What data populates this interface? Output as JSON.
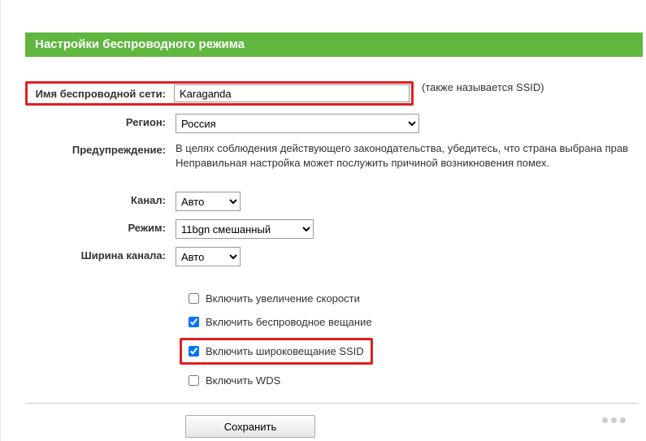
{
  "header": {
    "title": "Настройки беспроводного режима"
  },
  "form": {
    "ssid": {
      "label": "Имя беспроводной сети:",
      "value": "Karaganda",
      "note": "(также называется SSID)"
    },
    "region": {
      "label": "Регион:",
      "value": "Россия"
    },
    "warning": {
      "label": "Предупреждение:",
      "text1": "В целях соблюдения действующего законодательства, убедитесь, что страна выбрана прав",
      "text2": "Неправильная настройка может послужить причиной возникновения помех."
    },
    "channel": {
      "label": "Канал:",
      "value": "Авто"
    },
    "mode": {
      "label": "Режим:",
      "value": "11bgn смешанный"
    },
    "width": {
      "label": "Ширина канала:",
      "value": "Авто"
    },
    "checkboxes": {
      "speed": {
        "label": "Включить увеличение скорости",
        "checked": false
      },
      "radio": {
        "label": "Включить беспроводное вещание",
        "checked": true
      },
      "ssidbc": {
        "label": "Включить широковещание SSID",
        "checked": true
      },
      "wds": {
        "label": "Включить WDS",
        "checked": false
      }
    },
    "save": {
      "label": "Сохранить"
    }
  }
}
